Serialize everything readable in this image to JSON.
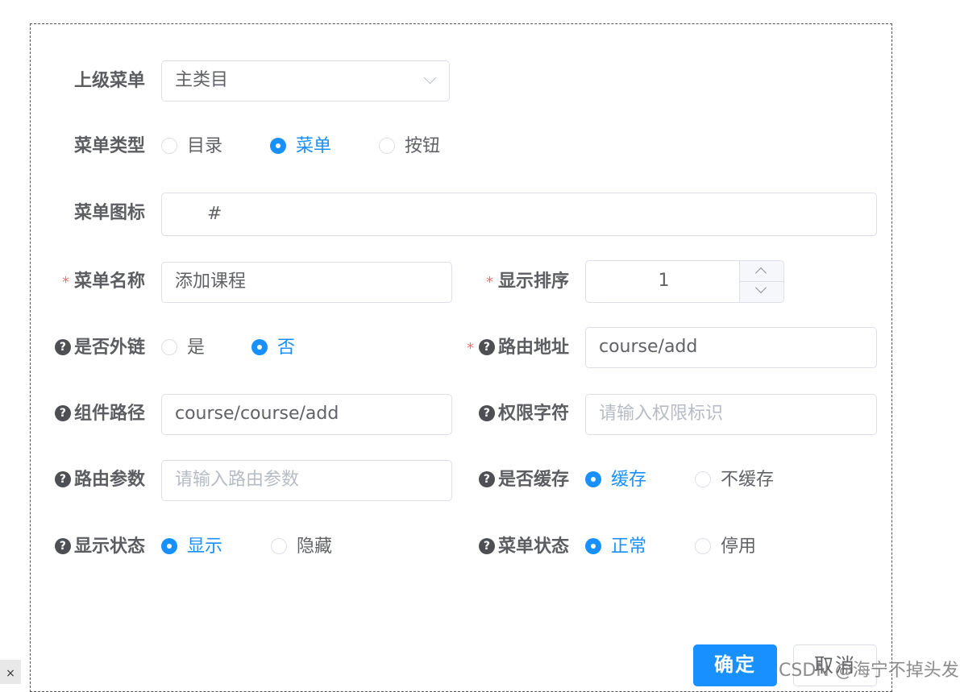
{
  "form": {
    "parent_menu": {
      "label": "上级菜单",
      "value": "主类目"
    },
    "menu_type": {
      "label": "菜单类型",
      "options": [
        "目录",
        "菜单",
        "按钮"
      ],
      "selected": "菜单"
    },
    "menu_icon": {
      "label": "菜单图标",
      "value": "#"
    },
    "menu_name": {
      "label": "菜单名称",
      "required_mark": "*",
      "value": "添加课程"
    },
    "display_order": {
      "label": "显示排序",
      "required_mark": "*",
      "value": "1"
    },
    "external_link": {
      "label": "是否外链",
      "help_icon": "question-circle-icon",
      "options": [
        "是",
        "否"
      ],
      "selected": "否"
    },
    "route_address": {
      "label": "路由地址",
      "required_mark": "*",
      "help_icon": "question-circle-icon",
      "value": "course/add"
    },
    "component_path": {
      "label": "组件路径",
      "help_icon": "question-circle-icon",
      "value": "course/course/add"
    },
    "permission": {
      "label": "权限字符",
      "help_icon": "question-circle-icon",
      "value": "",
      "placeholder": "请输入权限标识"
    },
    "route_params": {
      "label": "路由参数",
      "help_icon": "question-circle-icon",
      "value": "",
      "placeholder": "请输入路由参数"
    },
    "cache": {
      "label": "是否缓存",
      "help_icon": "question-circle-icon",
      "options": [
        "缓存",
        "不缓存"
      ],
      "selected": "缓存"
    },
    "visible": {
      "label": "显示状态",
      "help_icon": "question-circle-icon",
      "options": [
        "显示",
        "隐藏"
      ],
      "selected": "显示"
    },
    "status": {
      "label": "菜单状态",
      "help_icon": "question-circle-icon",
      "options": [
        "正常",
        "停用"
      ],
      "selected": "正常"
    }
  },
  "footer": {
    "confirm_label": "确定",
    "cancel_label": "取消"
  },
  "side_tab": {
    "close_glyph": "×"
  },
  "watermark": "CSDN @海宁不掉头发",
  "colors": {
    "primary": "#1890ff",
    "required": "#f56c6c",
    "border": "#dcdfe6"
  }
}
